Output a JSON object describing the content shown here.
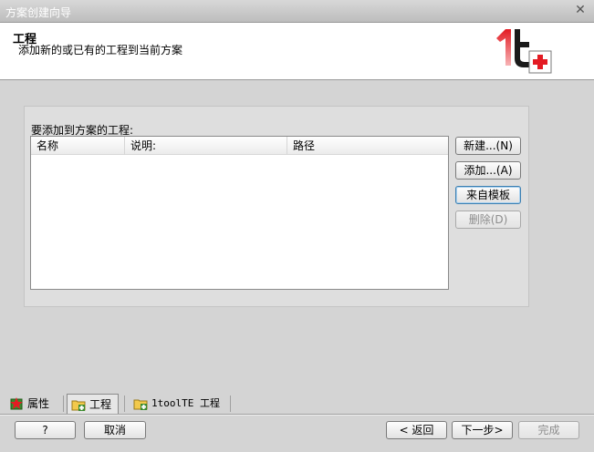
{
  "window": {
    "title": "方案创建向导",
    "close_glyph": "✕"
  },
  "header": {
    "title": "工程",
    "subtitle": "添加新的或已有的工程到当前方案",
    "logo_text": "1t"
  },
  "panel": {
    "label": "要添加到方案的工程:",
    "columns": [
      "名称",
      "说明:",
      "路径"
    ],
    "rows": []
  },
  "side_buttons": {
    "new": "新建...(N)",
    "add": "添加...(A)",
    "from_template": "来自模板",
    "delete": "删除(D)"
  },
  "tabs": [
    {
      "label": "属性",
      "icon": "properties-icon"
    },
    {
      "label": "工程",
      "icon": "project-icon"
    },
    {
      "label": "1toolTE 工程",
      "icon": "1toolte-project-icon"
    }
  ],
  "footer": {
    "help": "?",
    "cancel": "取消",
    "back": "< 返回",
    "next": "下一步>",
    "finish": "完成"
  },
  "colors": {
    "accent": "#e31b23",
    "focus": "#3c7fb1"
  }
}
